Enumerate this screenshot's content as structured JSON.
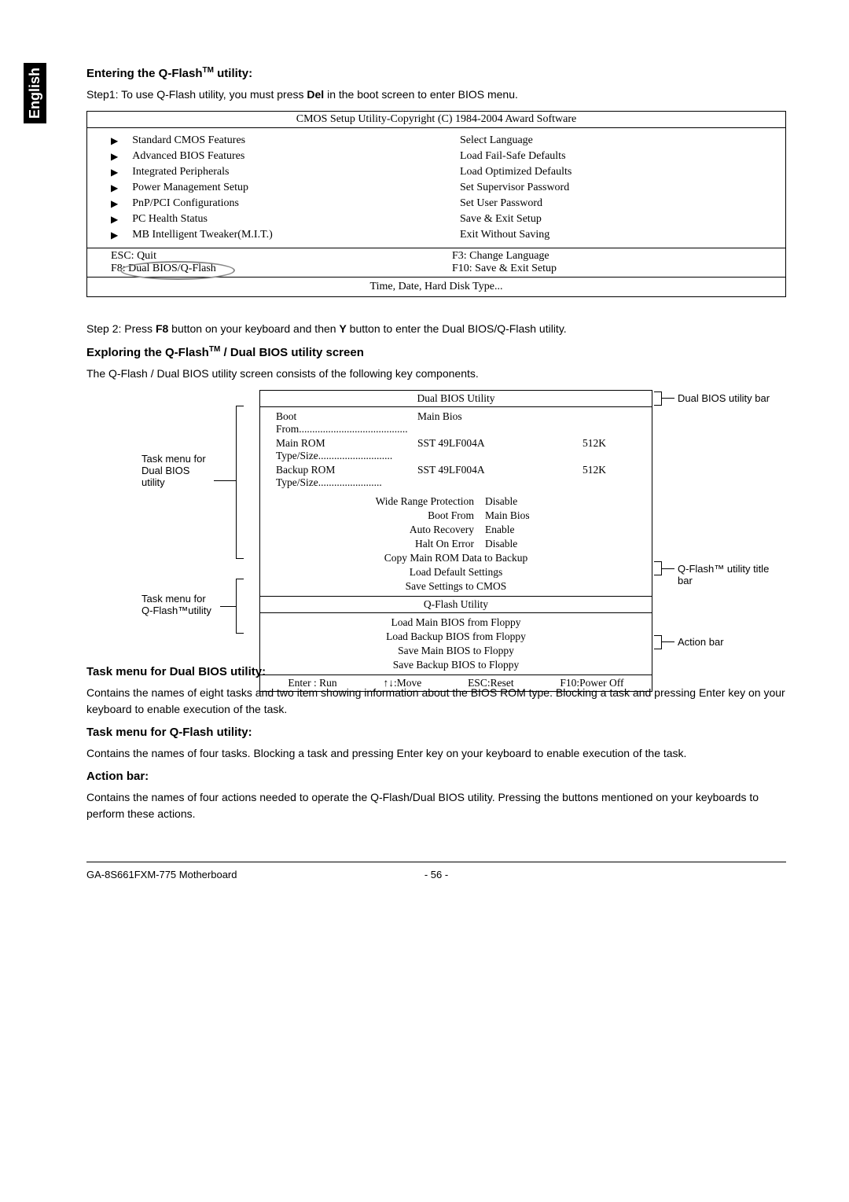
{
  "side_tab": "English",
  "section1": {
    "heading_pre": "Entering the Q-Flash",
    "heading_post": " utility:",
    "step1_pre": "Step1: To use Q-Flash utility, you must press ",
    "step1_bold": "Del",
    "step1_post": " in the boot screen to enter BIOS menu."
  },
  "bios": {
    "title": "CMOS Setup Utility-Copyright (C) 1984-2004 Award Software",
    "left": [
      "Standard CMOS Features",
      "Advanced BIOS Features",
      "Integrated Peripherals",
      "Power Management Setup",
      "PnP/PCI Configurations",
      "PC Health Status",
      "MB Intelligent Tweaker(M.I.T.)"
    ],
    "right": [
      "Select Language",
      "Load Fail-Safe Defaults",
      "Load Optimized Defaults",
      "Set Supervisor Password",
      "Set User Password",
      "Save & Exit Setup",
      "Exit Without Saving"
    ],
    "footer1": {
      "l1": "ESC: Quit",
      "l2": "F8: Dual BIOS/Q-Flash",
      "r1": "F3: Change Language",
      "r2": "F10: Save & Exit Setup"
    },
    "footer2": "Time, Date, Hard Disk Type..."
  },
  "step2": {
    "pre": "Step 2: Press ",
    "b1": "F8",
    "mid": " button on your keyboard and then ",
    "b2": "Y",
    "post": " button to enter the Dual BIOS/Q-Flash utility."
  },
  "section2": {
    "heading_pre": "Exploring the Q-Flash",
    "heading_post": " / Dual BIOS utility screen",
    "desc": "The Q-Flash / Dual BIOS utility screen consists of the following key components."
  },
  "util": {
    "title": "Dual BIOS Utility",
    "info": {
      "r1": {
        "a": "Boot From.........................................",
        "b": "Main Bios",
        "c": ""
      },
      "r2": {
        "a": "Main ROM Type/Size............................",
        "b": "SST 49LF004A",
        "c": "512K"
      },
      "r3": {
        "a": "Backup ROM Type/Size........................",
        "b": "SST 49LF004A",
        "c": "512K"
      }
    },
    "settings": [
      {
        "k": "Wide Range Protection",
        "v": "Disable"
      },
      {
        "k": "Boot From",
        "v": "Main Bios"
      },
      {
        "k": "Auto Recovery",
        "v": "Enable"
      },
      {
        "k": "Halt On Error",
        "v": "Disable"
      }
    ],
    "tasks1": [
      "Copy Main ROM Data to Backup",
      "Load Default Settings",
      "Save Settings to CMOS"
    ],
    "qf_title": "Q-Flash Utility",
    "tasks2": [
      "Load Main BIOS from Floppy",
      "Load Backup BIOS from Floppy",
      "Save Main BIOS to Floppy",
      "Save Backup BIOS to Floppy"
    ],
    "actions": {
      "a": "Enter : Run",
      "b": "↑↓:Move",
      "c": "ESC:Reset",
      "d": "F10:Power Off"
    }
  },
  "labels": {
    "l1a": "Task menu for",
    "l1b": "Dual BIOS",
    "l1c": "utility",
    "l2a": "Task menu for",
    "l2b": "Q-Flash™utility",
    "r1": "Dual BIOS utility bar",
    "r2a": "Q-Flash™ utility title",
    "r2b": "bar",
    "r3": "Action bar"
  },
  "section3": {
    "h1": "Task menu for Dual BIOS utility:",
    "p1": "Contains the names of eight tasks and two item showing information about the BIOS ROM type. Blocking a task and pressing Enter key on your keyboard to enable execution of the task.",
    "h2": "Task menu for Q-Flash utility:",
    "p2": "Contains the names of four tasks. Blocking a task and pressing Enter key on your keyboard to enable execution of the task.",
    "h3": "Action bar:",
    "p3": "Contains the names of four actions needed to operate the Q-Flash/Dual BIOS utility. Pressing the buttons mentioned on your keyboards to perform these actions."
  },
  "footer": {
    "left": "GA-8S661FXM-775 Motherboard",
    "center": "- 56 -"
  }
}
